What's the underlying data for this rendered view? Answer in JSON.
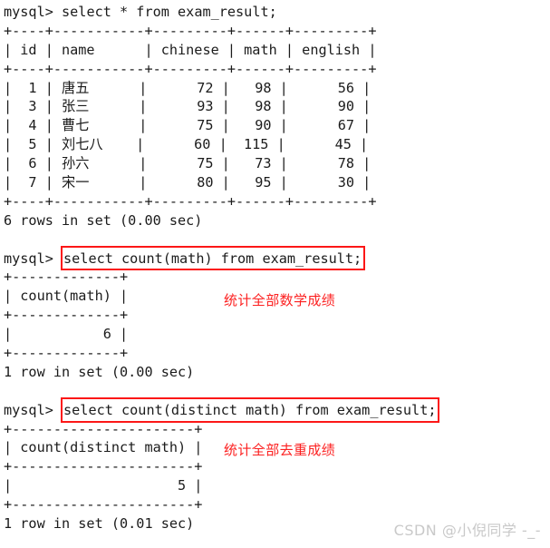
{
  "terminal": {
    "prompt": "mysql> ",
    "lines": [
      {
        "id": "q1-prompt",
        "kind": "command",
        "prompt": "mysql> ",
        "sql": "select * from exam_result;",
        "boxed": false
      },
      {
        "id": "t1-top",
        "kind": "rule",
        "text": "+----+-----------+---------+------+---------+"
      },
      {
        "id": "t1-head",
        "kind": "row",
        "text": "| id | name      | chinese | math | english |"
      },
      {
        "id": "t1-sep",
        "kind": "rule",
        "text": "+----+-----------+---------+------+---------+"
      },
      {
        "id": "t1-r1",
        "kind": "row",
        "text": "|  1 | 唐五      |      72 |   98 |      56 |"
      },
      {
        "id": "t1-r2",
        "kind": "row",
        "text": "|  3 | 张三      |      93 |   98 |      90 |"
      },
      {
        "id": "t1-r3",
        "kind": "row",
        "text": "|  4 | 曹七      |      75 |   90 |      67 |"
      },
      {
        "id": "t1-r4",
        "kind": "row",
        "text": "|  5 | 刘七八    |      60 |  115 |      45 |"
      },
      {
        "id": "t1-r5",
        "kind": "row",
        "text": "|  6 | 孙六      |      75 |   73 |      78 |"
      },
      {
        "id": "t1-r6",
        "kind": "row",
        "text": "|  7 | 宋一      |      80 |   95 |      30 |"
      },
      {
        "id": "t1-bot",
        "kind": "rule",
        "text": "+----+-----------+---------+------+---------+"
      },
      {
        "id": "t1-status",
        "kind": "status",
        "text": "6 rows in set (0.00 sec)"
      },
      {
        "id": "blank-1",
        "kind": "blank",
        "text": " "
      },
      {
        "id": "q2-prompt",
        "kind": "command",
        "prompt": "mysql> ",
        "sql": "select count(math) from exam_result;",
        "boxed": true
      },
      {
        "id": "t2-top",
        "kind": "rule",
        "text": "+-------------+"
      },
      {
        "id": "t2-head",
        "kind": "row",
        "text": "| count(math) |"
      },
      {
        "id": "t2-sep",
        "kind": "rule",
        "text": "+-------------+"
      },
      {
        "id": "t2-r1",
        "kind": "row",
        "text": "|           6 |"
      },
      {
        "id": "t2-bot",
        "kind": "rule",
        "text": "+-------------+"
      },
      {
        "id": "t2-status",
        "kind": "status",
        "text": "1 row in set (0.00 sec)"
      },
      {
        "id": "blank-2",
        "kind": "blank",
        "text": " "
      },
      {
        "id": "q3-prompt",
        "kind": "command",
        "prompt": "mysql> ",
        "sql": "select count(distinct math) from exam_result;",
        "boxed": true
      },
      {
        "id": "t3-top",
        "kind": "rule",
        "text": "+----------------------+"
      },
      {
        "id": "t3-head",
        "kind": "row",
        "text": "| count(distinct math) |"
      },
      {
        "id": "t3-sep",
        "kind": "rule",
        "text": "+----------------------+"
      },
      {
        "id": "t3-r1",
        "kind": "row",
        "text": "|                    5 |"
      },
      {
        "id": "t3-bot",
        "kind": "rule",
        "text": "+----------------------+"
      },
      {
        "id": "t3-status",
        "kind": "status",
        "text": "1 row in set (0.01 sec)"
      }
    ]
  },
  "queries": {
    "select_all": "select * from exam_result;",
    "count_math": "select count(math) from exam_result;",
    "count_distinct_math": "select count(distinct math) from exam_result;"
  },
  "result_table": {
    "columns": [
      "id",
      "name",
      "chinese",
      "math",
      "english"
    ],
    "rows": [
      {
        "id": "1",
        "name": "唐五",
        "chinese": "72",
        "math": "98",
        "english": "56"
      },
      {
        "id": "3",
        "name": "张三",
        "chinese": "93",
        "math": "98",
        "english": "90"
      },
      {
        "id": "4",
        "name": "曹七",
        "chinese": "75",
        "math": "90",
        "english": "67"
      },
      {
        "id": "5",
        "name": "刘七八",
        "chinese": "60",
        "math": "115",
        "english": "45"
      },
      {
        "id": "6",
        "name": "孙六",
        "chinese": "75",
        "math": "73",
        "english": "78"
      },
      {
        "id": "7",
        "name": "宋一",
        "chinese": "80",
        "math": "95",
        "english": "30"
      }
    ],
    "status": "6 rows in set (0.00 sec)"
  },
  "count_math_result": {
    "column": "count(math)",
    "value": "6",
    "status": "1 row in set (0.00 sec)"
  },
  "count_distinct_result": {
    "column": "count(distinct math)",
    "value": "5",
    "status": "1 row in set (0.01 sec)"
  },
  "annotations": {
    "count_math": "统计全部数学成绩",
    "count_distinct": "统计全部去重成绩"
  },
  "watermark": "CSDN @小倪同学 -_-",
  "colors": {
    "background": "#ffffff",
    "text": "#1b1b1b",
    "highlight_box": "#fc1717",
    "annotation": "#fc2020",
    "watermark": "#c9c9c9"
  }
}
